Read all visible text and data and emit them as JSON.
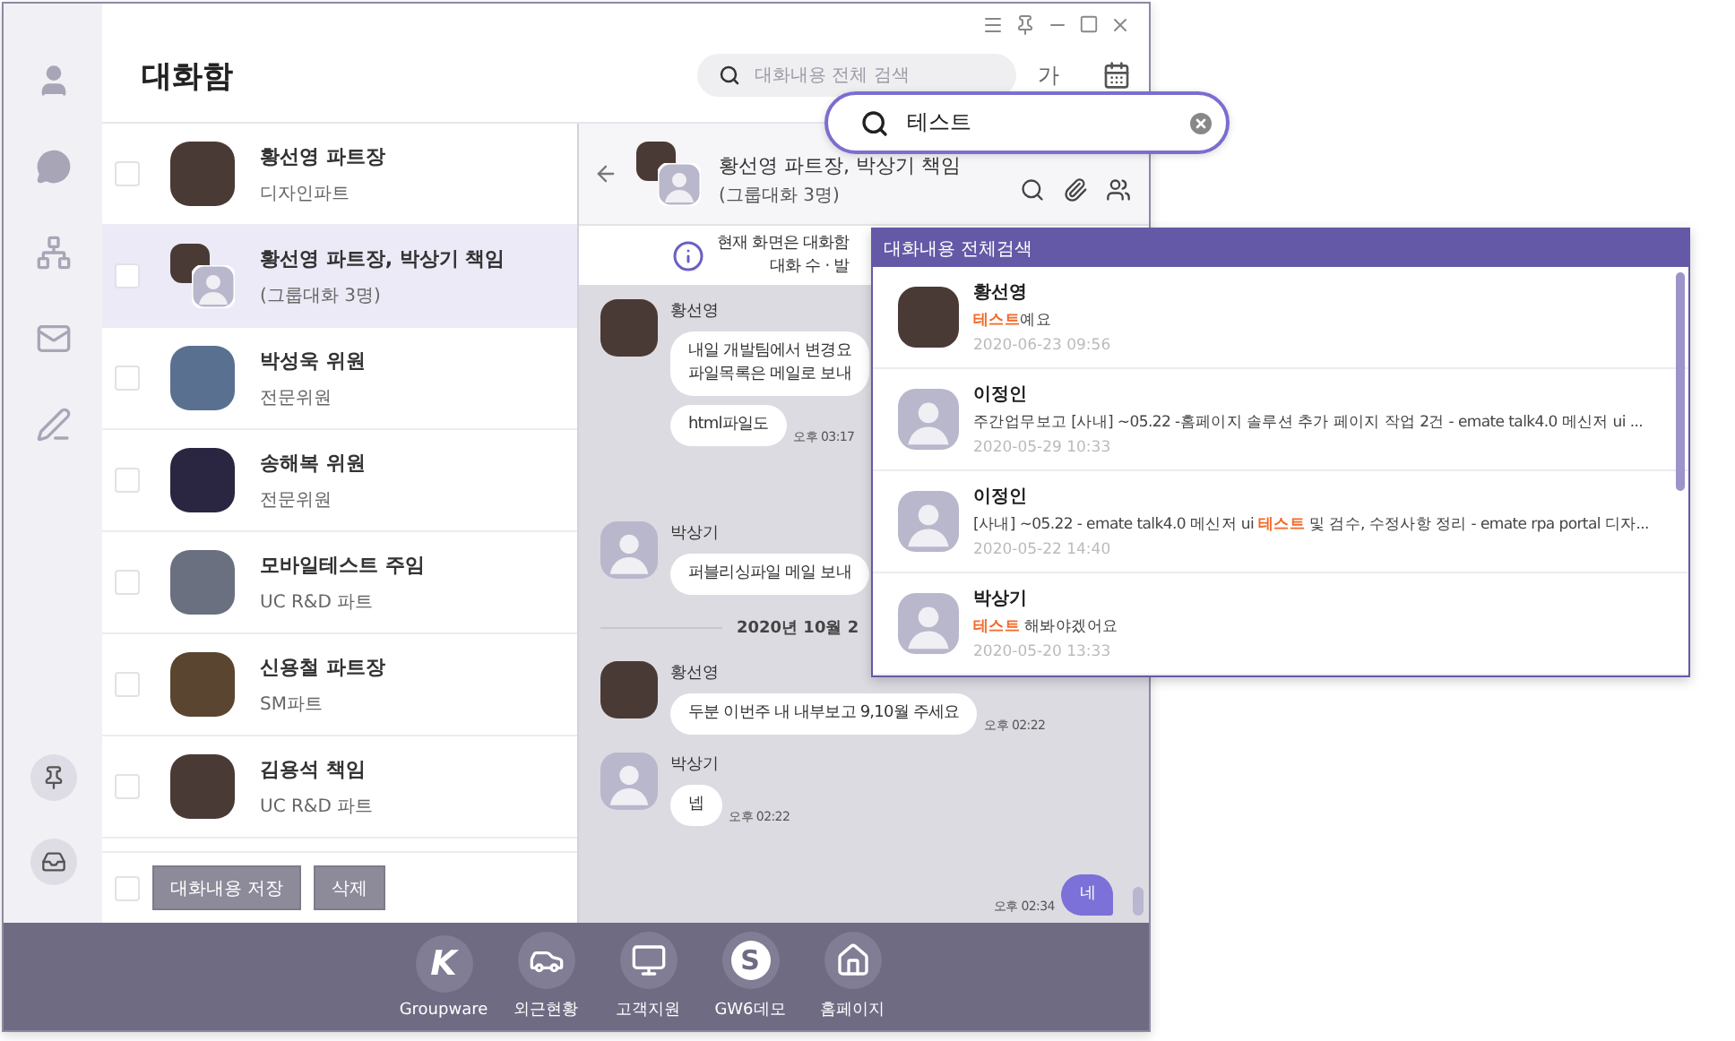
{
  "header": {
    "title": "대화함",
    "search": {
      "placeholder": "대화내용 전체 검색"
    },
    "font_button": "가"
  },
  "conversations": [
    {
      "name": "황선영 파트장",
      "sub": "디자인파트",
      "avatar": {
        "kind": "photo"
      },
      "selected": false,
      "checked": false
    },
    {
      "name": "황선영 파트장, 박상기 책임",
      "sub": "(그룹대화 3명)",
      "avatar": {
        "kind": "group"
      },
      "selected": true,
      "checked": false
    },
    {
      "name": "박성욱 위원",
      "sub": "전문위원",
      "avatar": {
        "kind": "photo"
      },
      "selected": false,
      "checked": false
    },
    {
      "name": "송해복 위원",
      "sub": "전문위원",
      "avatar": {
        "kind": "photo"
      },
      "selected": false,
      "checked": false
    },
    {
      "name": "모바일테스트 주임",
      "sub": "UC R&D 파트",
      "avatar": {
        "kind": "photo"
      },
      "selected": false,
      "checked": false
    },
    {
      "name": "신용철 파트장",
      "sub": "SM파트",
      "avatar": {
        "kind": "photo"
      },
      "selected": false,
      "checked": false
    },
    {
      "name": "김용석 책임",
      "sub": "UC R&D 파트",
      "avatar": {
        "kind": "photo"
      },
      "selected": false,
      "checked": false
    }
  ],
  "list_footer": {
    "checked": false,
    "buttons": [
      "대화내용 저장",
      "삭제"
    ]
  },
  "chat": {
    "title": "황선영 파트장, 박상기 책임",
    "subtitle": "(그룹대화 3명)",
    "notice": [
      "현재 화면은 대화함",
      "대화 수 · 발"
    ],
    "messages": [
      {
        "kind": "incoming",
        "sender": "황선영",
        "avatar": {
          "kind": "photo"
        },
        "bubbles": [
          {
            "lines": [
              "내일 개발팀에서 변경요",
              "파일목록은 메일로 보내"
            ]
          },
          {
            "lines": [
              "html파일도"
            ],
            "time": "오후 03:17"
          }
        ]
      },
      {
        "kind": "incoming",
        "sender": "박상기",
        "avatar": {
          "kind": "default"
        },
        "bubbles": [
          {
            "lines": [
              "퍼블리싱파일 메일 보내"
            ]
          }
        ]
      },
      {
        "kind": "date",
        "text": "2020년 10월 2"
      },
      {
        "kind": "incoming",
        "sender": "황선영",
        "avatar": {
          "kind": "photo"
        },
        "bubbles": [
          {
            "lines": [
              "두분 이번주 내 내부보고 9,10월 주세요"
            ],
            "time": "오후 02:22"
          }
        ]
      },
      {
        "kind": "incoming",
        "sender": "박상기",
        "avatar": {
          "kind": "default"
        },
        "bubbles": [
          {
            "lines": [
              "넵"
            ],
            "time": "오후 02:22"
          }
        ]
      },
      {
        "kind": "outgoing",
        "bubbles": [
          {
            "lines": [
              "네"
            ],
            "time": "오후 02:34"
          }
        ]
      }
    ]
  },
  "dock": [
    {
      "kind": "letter",
      "glyph": "K",
      "label": "Groupware"
    },
    {
      "kind": "car",
      "label": "외근현황"
    },
    {
      "kind": "monitor",
      "label": "고객지원"
    },
    {
      "kind": "badge",
      "glyph": "S",
      "label": "GW6데모"
    },
    {
      "kind": "home",
      "label": "홈페이지"
    }
  ],
  "search_callout": {
    "value": "테스트"
  },
  "results": {
    "title": "대화내용 전체검색",
    "items": [
      {
        "name": "황선영",
        "avatar": {
          "kind": "photo"
        },
        "parts": [
          {
            "text": "테스트",
            "highlight": true
          },
          {
            "text": "예요",
            "highlight": false
          }
        ],
        "date": "2020-06-23 09:56"
      },
      {
        "name": "이정인",
        "avatar": {
          "kind": "default"
        },
        "parts": [
          {
            "text": "주간업무보고 [사내] ~05.22 -홈페이지 솔루션 추가 페이지 작업 2건 - emate talk4.0 메신저 ui ...",
            "highlight": false
          }
        ],
        "date": "2020-05-29 10:33"
      },
      {
        "name": "이정인",
        "avatar": {
          "kind": "default"
        },
        "parts": [
          {
            "text": "[사내] ~05.22 - emate talk4.0 메신저 ui ",
            "highlight": false
          },
          {
            "text": "테스트",
            "highlight": true
          },
          {
            "text": " 및 검수, 수정사항 정리 - emate rpa portal 디자...",
            "highlight": false
          }
        ],
        "date": "2020-05-22 14:40"
      },
      {
        "name": "박상기",
        "avatar": {
          "kind": "default"
        },
        "parts": [
          {
            "text": "테스트",
            "highlight": true
          },
          {
            "text": " 해봐야겠어요",
            "highlight": false
          }
        ],
        "date": "2020-05-20 13:33"
      }
    ]
  }
}
